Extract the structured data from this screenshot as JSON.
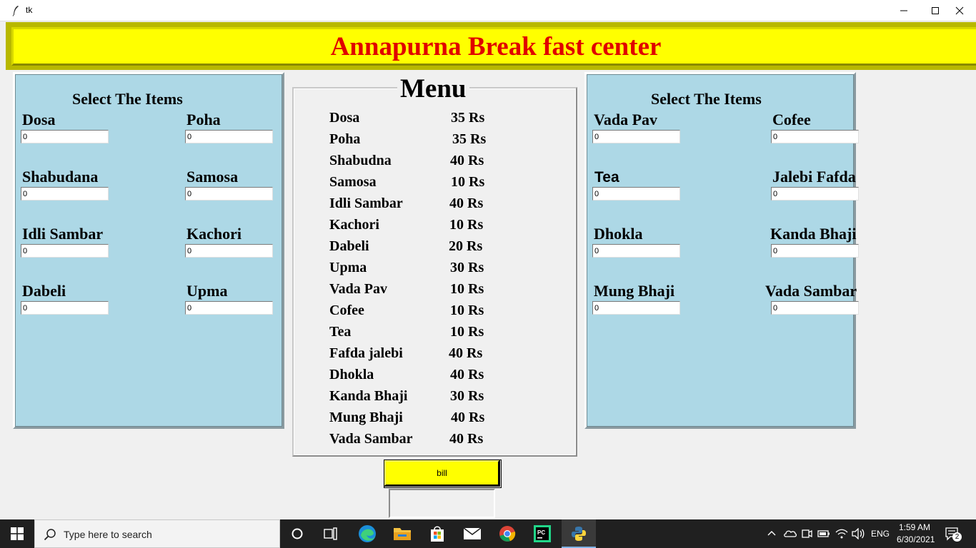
{
  "window": {
    "title": "tk",
    "controls": {
      "minimize": "minimize",
      "maximize": "maximize",
      "close": "close"
    }
  },
  "header": {
    "title": "Annapurna Break fast center",
    "colors": {
      "background": "#ffff00",
      "text": "#e00000"
    }
  },
  "left_panel": {
    "heading": "Select The Items",
    "items": [
      {
        "label": "Dosa",
        "value": "0"
      },
      {
        "label": "Poha",
        "value": "0"
      },
      {
        "label": "Shabudana",
        "value": "0"
      },
      {
        "label": "Samosa",
        "value": "0"
      },
      {
        "label": "Idli Sambar",
        "value": "0"
      },
      {
        "label": "Kachori",
        "value": "0"
      },
      {
        "label": "Dabeli",
        "value": "0"
      },
      {
        "label": "Upma",
        "value": "0"
      }
    ]
  },
  "right_panel": {
    "heading": "Select The Items",
    "items": [
      {
        "label": "Vada Pav",
        "value": "0"
      },
      {
        "label": "Cofee",
        "value": "0"
      },
      {
        "label": "Tea",
        "value": "0"
      },
      {
        "label": "Jalebi Fafda",
        "value": "0"
      },
      {
        "label": "Dhokla",
        "value": "0"
      },
      {
        "label": "Kanda Bhaji",
        "value": "0"
      },
      {
        "label": "Mung Bhaji",
        "value": "0"
      },
      {
        "label": "Vada Sambar",
        "value": "0"
      }
    ]
  },
  "menu": {
    "title": "Menu",
    "rows": [
      {
        "name": "Dosa",
        "price": "35 Rs"
      },
      {
        "name": "Poha",
        "price": "35 Rs"
      },
      {
        "name": "Shabudna",
        "price": "40 Rs"
      },
      {
        "name": "Samosa",
        "price": "10 Rs"
      },
      {
        "name": "Idli Sambar",
        "price": "40 Rs"
      },
      {
        "name": "Kachori",
        "price": "10 Rs"
      },
      {
        "name": "Dabeli",
        "price": "20 Rs"
      },
      {
        "name": "Upma",
        "price": "30 Rs"
      },
      {
        "name": "Vada Pav",
        "price": "10 Rs"
      },
      {
        "name": "Cofee",
        "price": "10 Rs"
      },
      {
        "name": "Tea",
        "price": "10 Rs"
      },
      {
        "name": "Fafda jalebi",
        "price": "40 Rs"
      },
      {
        "name": "Dhokla",
        "price": "40 Rs"
      },
      {
        "name": "Kanda Bhaji",
        "price": "30 Rs"
      },
      {
        "name": "Mung Bhaji",
        "price": "40 Rs"
      },
      {
        "name": "Vada Sambar",
        "price": "40 Rs"
      }
    ]
  },
  "bill": {
    "button_label": "bill",
    "output": ""
  },
  "taskbar": {
    "search_placeholder": "Type here to search",
    "apps": [
      "cortana-icon",
      "task-view-icon",
      "edge-icon",
      "file-explorer-icon",
      "store-icon",
      "mail-icon",
      "chrome-icon",
      "pycharm-icon",
      "python-icon"
    ],
    "tray": {
      "language": "ENG",
      "time": "1:59 AM",
      "date": "6/30/2021",
      "notification_count": "2"
    }
  },
  "colors": {
    "panel_bg": "#add8e6",
    "window_bg": "#f0f0f0",
    "button_bg": "#ffff00",
    "taskbar_bg": "#202020"
  }
}
